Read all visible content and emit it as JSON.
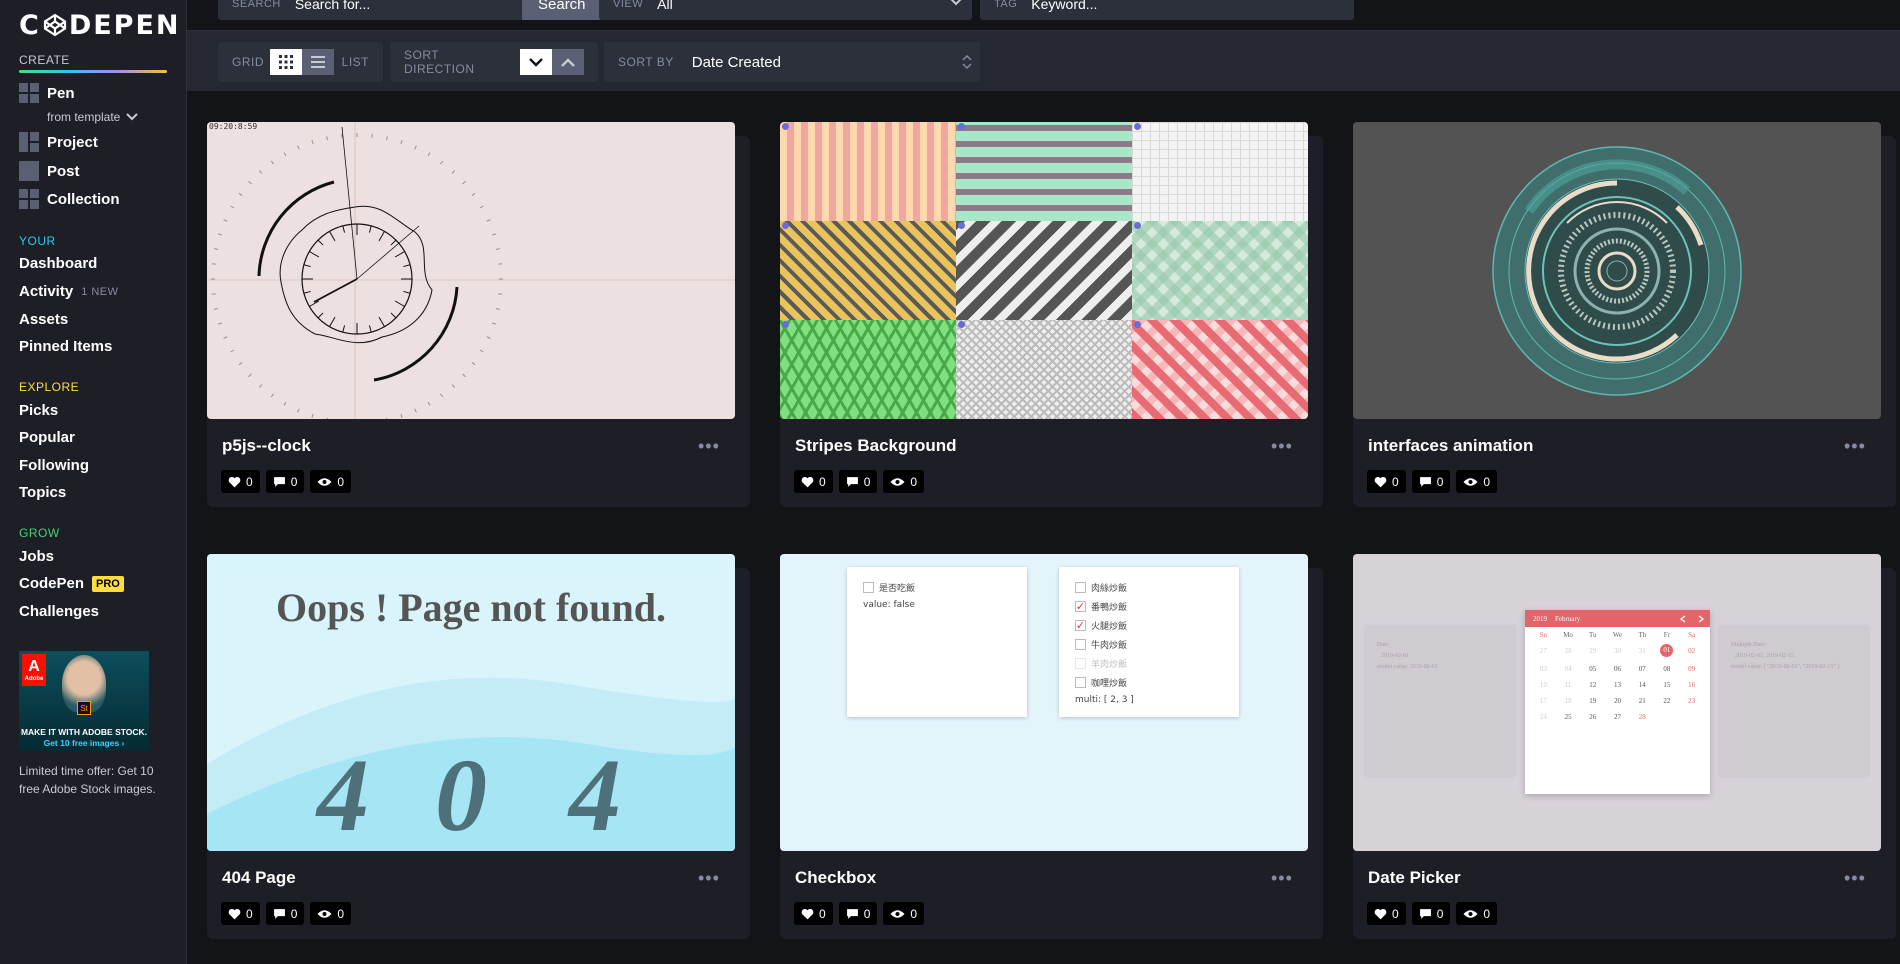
{
  "logo": {
    "text": "C DEPEN"
  },
  "sidebar": {
    "create_title": "CREATE",
    "create_items": [
      {
        "label": "Pen",
        "icon": "pen-icon"
      },
      {
        "label": "Project",
        "icon": "project-icon"
      },
      {
        "label": "Post",
        "icon": "post-icon"
      },
      {
        "label": "Collection",
        "icon": "collection-icon"
      }
    ],
    "from_template": "from template",
    "your_title": "YOUR",
    "your_items": [
      "Dashboard",
      "Activity",
      "Assets",
      "Pinned Items"
    ],
    "activity_badge": "1 NEW",
    "explore_title": "EXPLORE",
    "explore_items": [
      "Picks",
      "Popular",
      "Following",
      "Topics"
    ],
    "grow_title": "GROW",
    "grow_items": [
      "Jobs",
      "CodePen",
      "Challenges"
    ],
    "pro_badge": "PRO",
    "ad": {
      "brand": "A",
      "brand_small": "Adobe",
      "product": "St",
      "line1": "MAKE IT WITH ADOBE STOCK.",
      "line2": "Get 10 free images ›"
    },
    "ad_caption": "Limited time offer: Get 10 free Adobe Stock images."
  },
  "topbar": {
    "search_label": "SEARCH",
    "search_placeholder": "Search for...",
    "search_button": "Search",
    "view_label": "VIEW",
    "view_value": "All",
    "tag_label": "TAG",
    "tag_placeholder": "Keyword..."
  },
  "toolbar": {
    "grid_label": "GRID",
    "list_label": "LIST",
    "sort_direction_label": "SORT DIRECTION",
    "sort_by_label": "SORT BY",
    "sort_by_value": "Date Created"
  },
  "colors": {
    "accent_green": "#47cf73",
    "accent_blue": "#2bc7ee",
    "accent_yellow": "#ffdd40",
    "sidebar_bg": "#1e1f26",
    "page_bg": "#131417"
  },
  "cards": [
    {
      "title": "p5js--clock",
      "likes": "0",
      "comments": "0",
      "views": "0"
    },
    {
      "title": "Stripes Background",
      "likes": "0",
      "comments": "0",
      "views": "0"
    },
    {
      "title": "interfaces animation",
      "likes": "0",
      "comments": "0",
      "views": "0"
    },
    {
      "title": "404 Page",
      "likes": "0",
      "comments": "0",
      "views": "0"
    },
    {
      "title": "Checkbox",
      "likes": "0",
      "comments": "0",
      "views": "0"
    },
    {
      "title": "Date Picker",
      "likes": "0",
      "comments": "0",
      "views": "0"
    }
  ],
  "previews": {
    "clock_time": "09:20:8:59",
    "page404_title": "Oops ! Page not found.",
    "page404_digits": [
      "4",
      "0",
      "4"
    ],
    "checkbox_left": {
      "label": "是否吃飯",
      "value": "value: false"
    },
    "checkbox_right": {
      "options": [
        "肉絲炒飯",
        "番鴨炒飯",
        "火腿炒飯",
        "牛肉炒飯",
        "羊肉炒飯",
        "咖哩炒飯"
      ],
      "checked": [
        false,
        true,
        true,
        false,
        false,
        false
      ],
      "disabled": [
        false,
        false,
        false,
        false,
        true,
        false
      ],
      "value": "multi: [ 2, 3 ]"
    },
    "datepicker": {
      "year": "2019",
      "month": "February",
      "weekdays": [
        "Su",
        "Mo",
        "Tu",
        "We",
        "Th",
        "Fr",
        "Sa"
      ],
      "weeks": [
        [
          "27",
          "28",
          "29",
          "30",
          "31",
          "01",
          "02"
        ],
        [
          "03",
          "04",
          "05",
          "06",
          "07",
          "08",
          "09"
        ],
        [
          "10",
          "11",
          "12",
          "13",
          "14",
          "15",
          "16"
        ],
        [
          "17",
          "18",
          "19",
          "20",
          "21",
          "22",
          "23"
        ],
        [
          "24",
          "25",
          "26",
          "27",
          "28",
          "",
          ""
        ]
      ],
      "selected_day": "01",
      "left_label": "Date:",
      "left_value": "2019-02-01",
      "left_model": "model value: 2019-02-01",
      "right_label": "Multiple Date:",
      "right_value": "2019-02-01, 2019-02-15,",
      "right_model": "model value: [ \"2019-02-01\", \"2019-02-15\" ]"
    }
  }
}
